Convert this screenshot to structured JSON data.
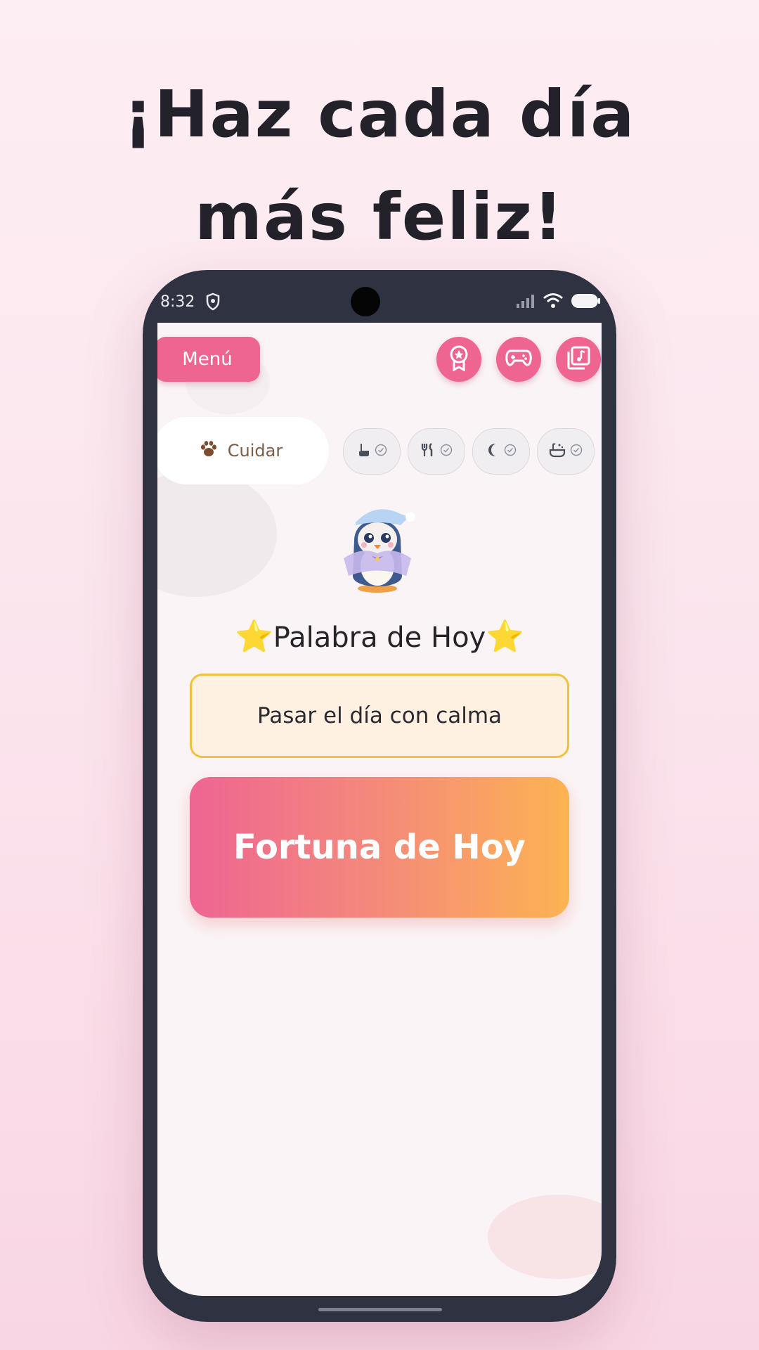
{
  "headline": {
    "line1": "¡Haz cada día",
    "line2": "más feliz!"
  },
  "status_bar": {
    "time": "8:32",
    "icons": [
      "shield-icon",
      "signal-icon",
      "wifi-icon",
      "battery-icon"
    ]
  },
  "top_bar": {
    "menu_label": "Menú",
    "buttons": [
      {
        "icon": "award-badge-icon"
      },
      {
        "icon": "gamepad-icon"
      },
      {
        "icon": "music-library-icon"
      }
    ]
  },
  "care_tabs": {
    "active_label": "Cuidar",
    "active_icon": "paw-icon",
    "tasks": [
      {
        "icon": "pointer-hand-icon",
        "status": "check-icon"
      },
      {
        "icon": "fork-knife-icon",
        "status": "check-icon"
      },
      {
        "icon": "moon-icon",
        "status": "check-icon"
      },
      {
        "icon": "bath-icon",
        "status": "check-icon"
      }
    ]
  },
  "word_of_day": {
    "star": "⭐",
    "title": "Palabra de Hoy",
    "text": "Pasar el día con calma"
  },
  "fortune": {
    "label": "Fortuna de Hoy"
  },
  "colors": {
    "accent_pink": "#ee6592",
    "accent_orange": "#fdb352",
    "phone_frame": "#2f3341",
    "word_box_border": "#f0c23e",
    "word_box_bg": "#fef1e1"
  }
}
